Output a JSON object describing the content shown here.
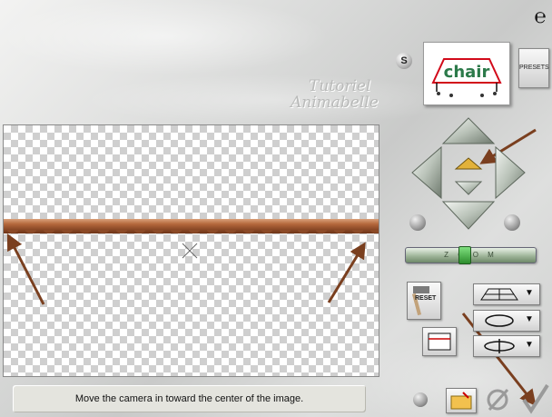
{
  "status_message": "Move the camera in toward the center of the image.",
  "toolbar": {
    "s_label": "S",
    "presets_label": "PRESETS",
    "reset_label": "RESET",
    "zoom_label": "Z O O M"
  },
  "preview": {
    "word": "chair"
  },
  "watermark": {
    "line1": "Tutoriel",
    "line2": "Animabelle"
  },
  "zoom_level": 0.45,
  "colors": {
    "annotation_arrow": "#7a3f1f",
    "roof_mid": "#b4683c",
    "nav_button": "#b9c2b8",
    "zoom_green": "#2c8c2c"
  },
  "icons": [
    "logo-icon",
    "s-icon",
    "presets-icon",
    "arrow-up-icon",
    "arrow-down-icon",
    "arrow-left-icon",
    "arrow-right-icon",
    "move-up-icon",
    "move-down-icon",
    "rotate-left-icon",
    "rotate-right-icon",
    "hammer-icon",
    "grid-floor-icon",
    "rotate-loop-icon",
    "orbit-icon",
    "frame-icon",
    "grid-icon",
    "open-folder-icon",
    "cancel-icon",
    "ok-check-icon"
  ]
}
